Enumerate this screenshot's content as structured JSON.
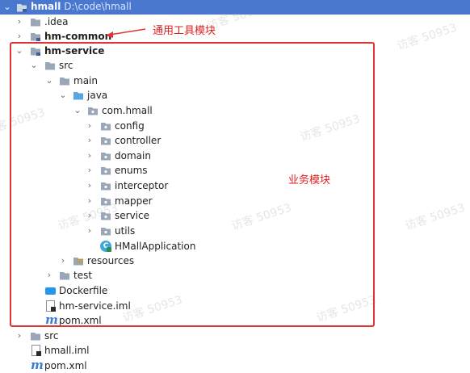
{
  "project": {
    "name": "hmall",
    "path": "D:\\code\\hmall"
  },
  "annotations": {
    "common_label": "通用工具模块",
    "service_label": "业务模块",
    "highlight_color": "#e03535"
  },
  "watermark": "访客 50953",
  "tree": {
    "idea": ".idea",
    "hm_common": "hm-common",
    "hm_service": "hm-service",
    "src": "src",
    "main": "main",
    "java": "java",
    "package": "com.hmall",
    "packages": [
      "config",
      "controller",
      "domain",
      "enums",
      "interceptor",
      "mapper",
      "service",
      "utils"
    ],
    "app_class": "HMallApplication",
    "resources": "resources",
    "test": "test",
    "dockerfile": "Dockerfile",
    "service_iml": "hm-service.iml",
    "service_pom": "pom.xml",
    "root_src": "src",
    "root_iml": "hmall.iml",
    "root_pom": "pom.xml"
  },
  "colors": {
    "selection": "#4a78cf",
    "folder": "#9aa7b8",
    "source_folder": "#5aa6df"
  }
}
